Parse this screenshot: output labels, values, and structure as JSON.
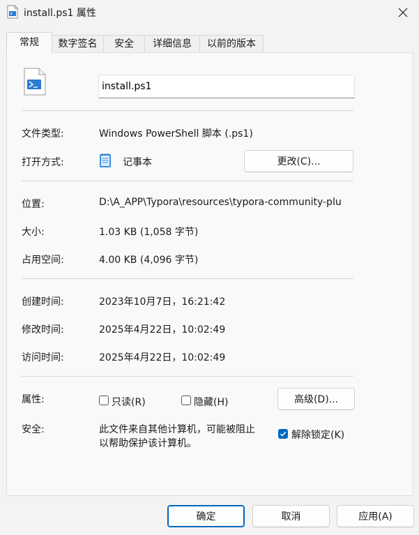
{
  "window": {
    "title": "install.ps1 属性"
  },
  "tabs": [
    "常规",
    "数字签名",
    "安全",
    "详细信息",
    "以前的版本"
  ],
  "general": {
    "file_name": "install.ps1",
    "type_label": "文件类型:",
    "type_value": "Windows PowerShell 脚本 (.ps1)",
    "opens_with_label": "打开方式:",
    "opens_with_value": "记事本",
    "change_button": "更改(C)...",
    "location_label": "位置:",
    "location_value": "D:\\A_APP\\Typora\\resources\\typora-community-plu",
    "size_label": "大小:",
    "size_value": "1.03 KB (1,058 字节)",
    "disk_size_label": "占用空间:",
    "disk_size_value": "4.00 KB (4,096 字节)",
    "created_label": "创建时间:",
    "created_value": "2023年10月7日，16:21:42",
    "modified_label": "修改时间:",
    "modified_value": "2025年4月22日，10:02:49",
    "accessed_label": "访问时间:",
    "accessed_value": "2025年4月22日，10:02:49",
    "attributes_label": "属性:",
    "readonly_label": "只读(R)",
    "readonly_checked": false,
    "hidden_label": "隐藏(H)",
    "hidden_checked": false,
    "advanced_button": "高级(D)...",
    "security_label": "安全:",
    "security_text_line1": "此文件来自其他计算机，可能被阻止",
    "security_text_line2": "以帮助保护该计算机。",
    "unblock_label": "解除锁定(K)",
    "unblock_checked": true
  },
  "footer": {
    "ok": "确定",
    "cancel": "取消",
    "apply": "应用(A)"
  },
  "colors": {
    "accent": "#0067c0",
    "background": "#f3f3f3",
    "panel": "#f9f9f9"
  }
}
